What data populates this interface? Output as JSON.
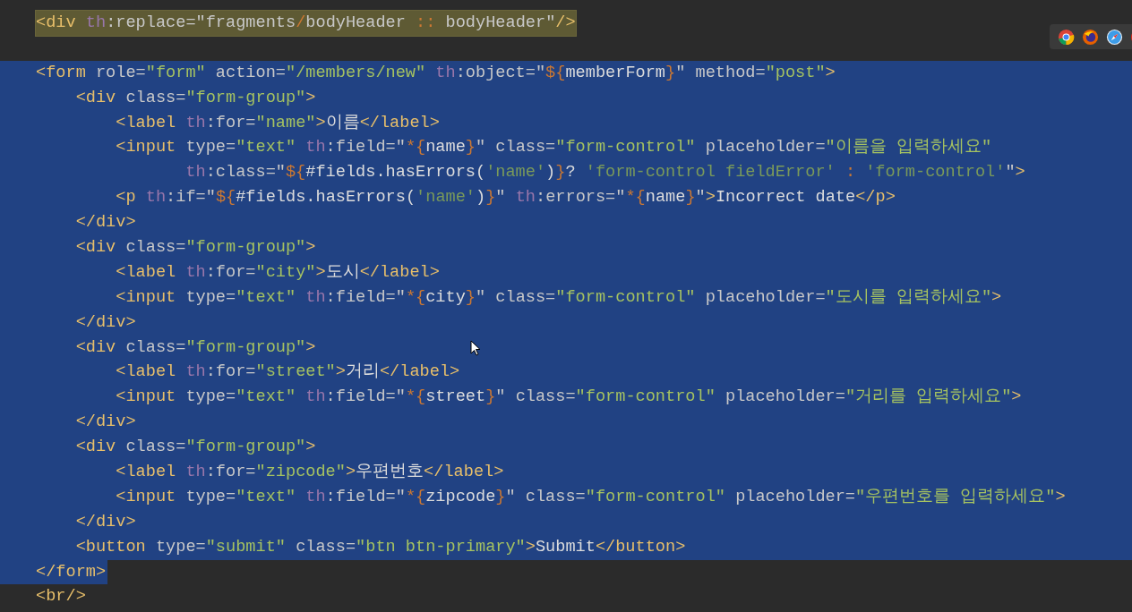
{
  "toolbar": {
    "icons": [
      {
        "kind": "chrome"
      },
      {
        "kind": "firefox"
      },
      {
        "kind": "safari"
      },
      {
        "kind": "red"
      }
    ]
  },
  "lines": [
    {
      "selected": false,
      "highlighted": true,
      "tokens": [
        {
          "kind": "tag",
          "text": "<div"
        },
        {
          "kind": "ns",
          "text": " th"
        },
        {
          "kind": "attr",
          "text": ":replace=\"fragments"
        },
        {
          "kind": "op",
          "text": "/"
        },
        {
          "kind": "attr",
          "text": "bodyHeader "
        },
        {
          "kind": "op",
          "text": "::"
        },
        {
          "kind": "attr",
          "text": " bodyHeader\""
        },
        {
          "kind": "tag",
          "text": "/>"
        }
      ]
    },
    {
      "selected": false,
      "highlighted": false
    },
    {
      "selected": true,
      "selected_to_end": true,
      "highlighted": false,
      "tokens": [
        {
          "kind": "tag",
          "text": "<form"
        },
        {
          "kind": "attr",
          "text": " role="
        },
        {
          "kind": "str",
          "text": "\"form\""
        },
        {
          "kind": "attr",
          "text": " action="
        },
        {
          "kind": "str",
          "text": "\"/members/new\""
        },
        {
          "kind": "ns",
          "text": " th"
        },
        {
          "kind": "attr",
          "text": ":object=\""
        },
        {
          "kind": "op",
          "text": "${"
        },
        {
          "kind": "text",
          "text": "memberForm"
        },
        {
          "kind": "op",
          "text": "}"
        },
        {
          "kind": "attr",
          "text": "\""
        },
        {
          "kind": "attr",
          "text": " method="
        },
        {
          "kind": "str",
          "text": "\"post\""
        },
        {
          "kind": "tag",
          "text": ">"
        }
      ]
    },
    {
      "selected": true,
      "selected_to_end": true,
      "highlighted": false,
      "tokens": [
        {
          "kind": "tag",
          "text": "    <div"
        },
        {
          "kind": "attr",
          "text": " class="
        },
        {
          "kind": "str",
          "text": "\"form-group\""
        },
        {
          "kind": "tag",
          "text": ">"
        }
      ]
    },
    {
      "selected": true,
      "selected_to_end": true,
      "highlighted": false,
      "tokens": [
        {
          "kind": "tag",
          "text": "        <label"
        },
        {
          "kind": "ns",
          "text": " th"
        },
        {
          "kind": "attr",
          "text": ":for="
        },
        {
          "kind": "str",
          "text": "\"name\""
        },
        {
          "kind": "tag",
          "text": ">"
        },
        {
          "kind": "text",
          "text": "이름"
        },
        {
          "kind": "tag",
          "text": "</label>"
        }
      ]
    },
    {
      "selected": true,
      "selected_to_end": true,
      "highlighted": false,
      "tokens": [
        {
          "kind": "tag",
          "text": "        <input"
        },
        {
          "kind": "attr",
          "text": " type="
        },
        {
          "kind": "str",
          "text": "\"text\""
        },
        {
          "kind": "ns",
          "text": " th"
        },
        {
          "kind": "attr",
          "text": ":field=\""
        },
        {
          "kind": "op",
          "text": "*{"
        },
        {
          "kind": "text",
          "text": "name"
        },
        {
          "kind": "op",
          "text": "}"
        },
        {
          "kind": "attr",
          "text": "\" class="
        },
        {
          "kind": "str",
          "text": "\"form-control\""
        },
        {
          "kind": "attr",
          "text": " placeholder="
        },
        {
          "kind": "str",
          "text": "\"이름을 입력하세요\""
        }
      ]
    },
    {
      "selected": true,
      "selected_to_end": true,
      "highlighted": false,
      "tokens": [
        {
          "kind": "ns",
          "text": "               th"
        },
        {
          "kind": "attr",
          "text": ":class=\""
        },
        {
          "kind": "op",
          "text": "${"
        },
        {
          "kind": "text",
          "text": "#fields.hasErrors("
        },
        {
          "kind": "quote",
          "text": "'name'"
        },
        {
          "kind": "text",
          "text": ")"
        },
        {
          "kind": "op",
          "text": "}"
        },
        {
          "kind": "text",
          "text": "? "
        },
        {
          "kind": "quote",
          "text": "'form-control fieldError'"
        },
        {
          "kind": "op",
          "text": " : "
        },
        {
          "kind": "quote",
          "text": "'form-control'"
        },
        {
          "kind": "attr",
          "text": "\""
        },
        {
          "kind": "tag",
          "text": ">"
        }
      ]
    },
    {
      "selected": true,
      "selected_to_end": true,
      "highlighted": false,
      "tokens": [
        {
          "kind": "tag",
          "text": "        <p"
        },
        {
          "kind": "ns",
          "text": " th"
        },
        {
          "kind": "attr",
          "text": ":if=\""
        },
        {
          "kind": "op",
          "text": "${"
        },
        {
          "kind": "text",
          "text": "#fields.hasErrors("
        },
        {
          "kind": "quote",
          "text": "'name'"
        },
        {
          "kind": "text",
          "text": ")"
        },
        {
          "kind": "op",
          "text": "}"
        },
        {
          "kind": "attr",
          "text": "\""
        },
        {
          "kind": "ns",
          "text": " th"
        },
        {
          "kind": "attr",
          "text": ":errors=\""
        },
        {
          "kind": "op",
          "text": "*{"
        },
        {
          "kind": "text",
          "text": "name"
        },
        {
          "kind": "op",
          "text": "}"
        },
        {
          "kind": "attr",
          "text": "\""
        },
        {
          "kind": "tag",
          "text": ">"
        },
        {
          "kind": "text",
          "text": "Incorrect date"
        },
        {
          "kind": "tag",
          "text": "</p>"
        }
      ]
    },
    {
      "selected": true,
      "selected_to_end": true,
      "highlighted": false,
      "tokens": [
        {
          "kind": "tag",
          "text": "    </div>"
        }
      ]
    },
    {
      "selected": true,
      "selected_to_end": true,
      "highlighted": false,
      "tokens": [
        {
          "kind": "tag",
          "text": "    <div"
        },
        {
          "kind": "attr",
          "text": " class="
        },
        {
          "kind": "str",
          "text": "\"form-group\""
        },
        {
          "kind": "tag",
          "text": ">"
        }
      ]
    },
    {
      "selected": true,
      "selected_to_end": true,
      "highlighted": false,
      "tokens": [
        {
          "kind": "tag",
          "text": "        <label"
        },
        {
          "kind": "ns",
          "text": " th"
        },
        {
          "kind": "attr",
          "text": ":for="
        },
        {
          "kind": "str",
          "text": "\"city\""
        },
        {
          "kind": "tag",
          "text": ">"
        },
        {
          "kind": "text",
          "text": "도시"
        },
        {
          "kind": "tag",
          "text": "</label>"
        }
      ]
    },
    {
      "selected": true,
      "selected_to_end": true,
      "highlighted": false,
      "tokens": [
        {
          "kind": "tag",
          "text": "        <input"
        },
        {
          "kind": "attr",
          "text": " type="
        },
        {
          "kind": "str",
          "text": "\"text\""
        },
        {
          "kind": "ns",
          "text": " th"
        },
        {
          "kind": "attr",
          "text": ":field=\""
        },
        {
          "kind": "op",
          "text": "*{"
        },
        {
          "kind": "text",
          "text": "city"
        },
        {
          "kind": "op",
          "text": "}"
        },
        {
          "kind": "attr",
          "text": "\" class="
        },
        {
          "kind": "str",
          "text": "\"form-control\""
        },
        {
          "kind": "attr",
          "text": " placeholder="
        },
        {
          "kind": "str",
          "text": "\"도시를 입력하세요\""
        },
        {
          "kind": "tag",
          "text": ">"
        }
      ]
    },
    {
      "selected": true,
      "selected_to_end": true,
      "highlighted": false,
      "tokens": [
        {
          "kind": "tag",
          "text": "    </div>"
        }
      ]
    },
    {
      "selected": true,
      "selected_to_end": true,
      "highlighted": false,
      "tokens": [
        {
          "kind": "tag",
          "text": "    <div"
        },
        {
          "kind": "attr",
          "text": " class="
        },
        {
          "kind": "str",
          "text": "\"form-group\""
        },
        {
          "kind": "tag",
          "text": ">"
        }
      ]
    },
    {
      "selected": true,
      "selected_to_end": true,
      "highlighted": false,
      "tokens": [
        {
          "kind": "tag",
          "text": "        <label"
        },
        {
          "kind": "ns",
          "text": " th"
        },
        {
          "kind": "attr",
          "text": ":for="
        },
        {
          "kind": "str",
          "text": "\"street\""
        },
        {
          "kind": "tag",
          "text": ">"
        },
        {
          "kind": "text",
          "text": "거리"
        },
        {
          "kind": "tag",
          "text": "</label>"
        }
      ]
    },
    {
      "selected": true,
      "selected_to_end": true,
      "highlighted": false,
      "tokens": [
        {
          "kind": "tag",
          "text": "        <input"
        },
        {
          "kind": "attr",
          "text": " type="
        },
        {
          "kind": "str",
          "text": "\"text\""
        },
        {
          "kind": "ns",
          "text": " th"
        },
        {
          "kind": "attr",
          "text": ":field=\""
        },
        {
          "kind": "op",
          "text": "*{"
        },
        {
          "kind": "text",
          "text": "street"
        },
        {
          "kind": "op",
          "text": "}"
        },
        {
          "kind": "attr",
          "text": "\" class="
        },
        {
          "kind": "str",
          "text": "\"form-control\""
        },
        {
          "kind": "attr",
          "text": " placeholder="
        },
        {
          "kind": "str",
          "text": "\"거리를 입력하세요\""
        },
        {
          "kind": "tag",
          "text": ">"
        }
      ]
    },
    {
      "selected": true,
      "selected_to_end": true,
      "highlighted": false,
      "tokens": [
        {
          "kind": "tag",
          "text": "    </div>"
        }
      ]
    },
    {
      "selected": true,
      "selected_to_end": true,
      "highlighted": false,
      "tokens": [
        {
          "kind": "tag",
          "text": "    <div"
        },
        {
          "kind": "attr",
          "text": " class="
        },
        {
          "kind": "str",
          "text": "\"form-group\""
        },
        {
          "kind": "tag",
          "text": ">"
        }
      ]
    },
    {
      "selected": true,
      "selected_to_end": true,
      "highlighted": false,
      "tokens": [
        {
          "kind": "tag",
          "text": "        <label"
        },
        {
          "kind": "ns",
          "text": " th"
        },
        {
          "kind": "attr",
          "text": ":for="
        },
        {
          "kind": "str",
          "text": "\"zipcode\""
        },
        {
          "kind": "tag",
          "text": ">"
        },
        {
          "kind": "text",
          "text": "우편번호"
        },
        {
          "kind": "tag",
          "text": "</label>"
        }
      ]
    },
    {
      "selected": true,
      "selected_to_end": true,
      "highlighted": false,
      "tokens": [
        {
          "kind": "tag",
          "text": "        <input"
        },
        {
          "kind": "attr",
          "text": " type="
        },
        {
          "kind": "str",
          "text": "\"text\""
        },
        {
          "kind": "ns",
          "text": " th"
        },
        {
          "kind": "attr",
          "text": ":field=\""
        },
        {
          "kind": "op",
          "text": "*{"
        },
        {
          "kind": "text",
          "text": "zipcode"
        },
        {
          "kind": "op",
          "text": "}"
        },
        {
          "kind": "attr",
          "text": "\" class="
        },
        {
          "kind": "str",
          "text": "\"form-control\""
        },
        {
          "kind": "attr",
          "text": " placeholder="
        },
        {
          "kind": "str",
          "text": "\"우편번호를 입력하세요\""
        },
        {
          "kind": "tag",
          "text": ">"
        }
      ]
    },
    {
      "selected": true,
      "selected_to_end": true,
      "highlighted": false,
      "tokens": [
        {
          "kind": "tag",
          "text": "    </div>"
        }
      ]
    },
    {
      "selected": true,
      "selected_to_end": true,
      "highlighted": false,
      "tokens": [
        {
          "kind": "tag",
          "text": "    <button"
        },
        {
          "kind": "attr",
          "text": " type="
        },
        {
          "kind": "str",
          "text": "\"submit\""
        },
        {
          "kind": "attr",
          "text": " class="
        },
        {
          "kind": "str",
          "text": "\"btn btn-primary\""
        },
        {
          "kind": "tag",
          "text": ">"
        },
        {
          "kind": "text",
          "text": "Submit"
        },
        {
          "kind": "tag",
          "text": "</button>"
        }
      ]
    },
    {
      "selected": true,
      "selected_to_end": false,
      "highlighted": false,
      "tokens": [
        {
          "kind": "tag",
          "text": "</form>"
        }
      ]
    },
    {
      "selected": false,
      "highlighted": false,
      "tokens": [
        {
          "kind": "tag",
          "text": "<br/>"
        }
      ]
    }
  ]
}
